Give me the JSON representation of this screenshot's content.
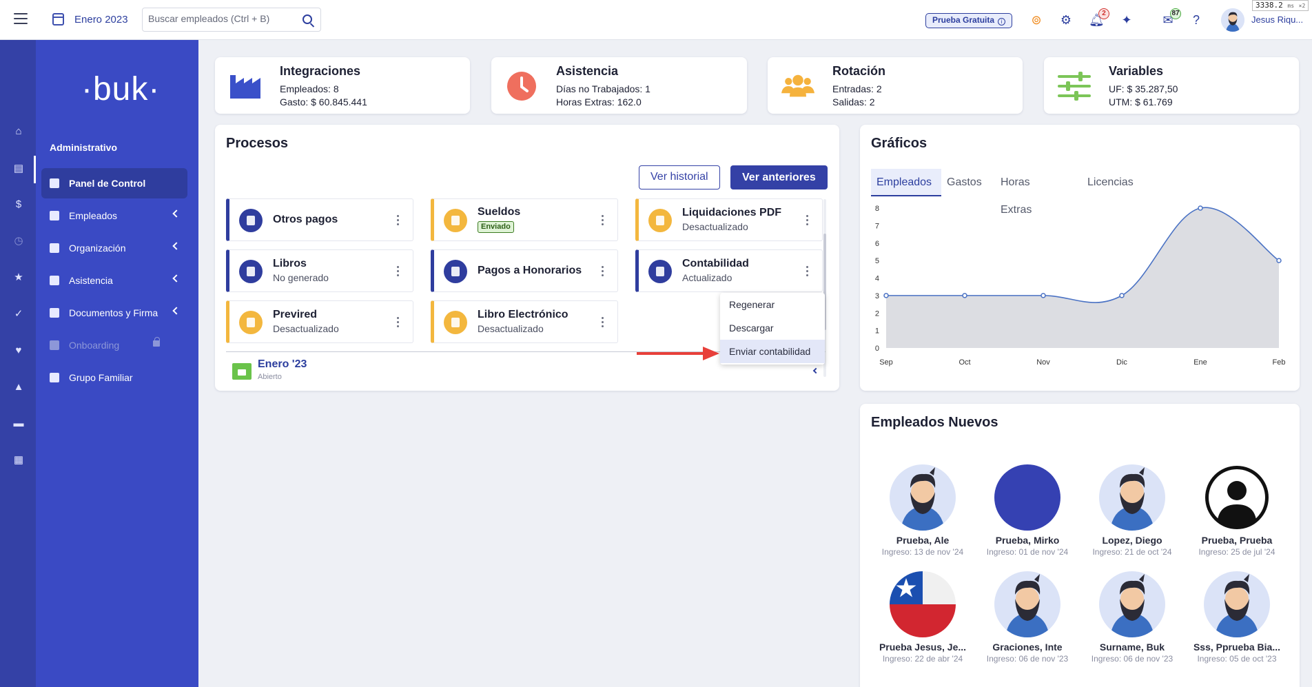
{
  "header": {
    "period": "Enero 2023",
    "search_placeholder": "Buscar empleados (Ctrl + B)",
    "trial_label": "Prueba Gratuita",
    "notifications_count": "2",
    "messages_count": "87",
    "user_name": "Jesus Riqu...",
    "timing": "3338.2",
    "timing_unit": "ms",
    "timing_suffix": "×2"
  },
  "sidebar": {
    "logo": "·buk·",
    "section": "Administrativo",
    "items": [
      {
        "label": "Panel de Control"
      },
      {
        "label": "Empleados"
      },
      {
        "label": "Organización"
      },
      {
        "label": "Asistencia"
      },
      {
        "label": "Documentos y Firma"
      },
      {
        "label": "Onboarding"
      },
      {
        "label": "Grupo Familiar"
      }
    ]
  },
  "kpis": [
    {
      "title": "Integraciones",
      "l1": "Empleados: 8",
      "l2": "Gasto: $ 60.845.441"
    },
    {
      "title": "Asistencia",
      "l1": "Días no Trabajados: 1",
      "l2": "Horas Extras: 162.0"
    },
    {
      "title": "Rotación",
      "l1": "Entradas: 2",
      "l2": "Salidas: 2"
    },
    {
      "title": "Variables",
      "l1": "UF: $ 35.287,50",
      "l2": "UTM: $ 61.769"
    }
  ],
  "processes": {
    "title": "Procesos",
    "btn_history": "Ver historial",
    "btn_previous": "Ver anteriores",
    "cards": [
      {
        "title": "Otros pagos",
        "sub": ""
      },
      {
        "title": "Sueldos",
        "tag": "Enviado"
      },
      {
        "title": "Liquidaciones PDF",
        "sub": "Desactualizado"
      },
      {
        "title": "Libros",
        "sub": "No generado"
      },
      {
        "title": "Pagos a Honorarios",
        "sub": ""
      },
      {
        "title": "Contabilidad",
        "sub": "Actualizado"
      },
      {
        "title": "Previred",
        "sub": "Desactualizado"
      },
      {
        "title": "Libro Electrónico",
        "sub": "Desactualizado"
      }
    ],
    "menu": [
      "Regenerar",
      "Descargar",
      "Enviar contabilidad"
    ],
    "period_name": "Enero '23",
    "period_status": "Abierto"
  },
  "charts_card": {
    "title": "Gráficos",
    "tabs": [
      "Empleados",
      "Gastos",
      "Horas Extras",
      "Licencias"
    ]
  },
  "chart_data": {
    "type": "area",
    "categories": [
      "Sep",
      "Oct",
      "Nov",
      "Dic",
      "Ene",
      "Feb"
    ],
    "values": [
      3,
      3,
      3,
      3,
      8,
      5
    ],
    "ylim": [
      0,
      8
    ],
    "yticks": [
      "0",
      "1",
      "2",
      "3",
      "4",
      "5",
      "6",
      "7",
      "8"
    ],
    "grid": false,
    "colors": {
      "line": "#4a72c4",
      "fill": "#dcdde2"
    }
  },
  "new_employees": {
    "title": "Empleados Nuevos",
    "items": [
      {
        "name": "Prueba, Ale",
        "date": "Ingreso: 13 de nov '24",
        "avatar": "bearded"
      },
      {
        "name": "Prueba, Mirko",
        "date": "Ingreso: 01 de nov '24",
        "avatar": "blue"
      },
      {
        "name": "Lopez, Diego",
        "date": "Ingreso: 21 de oct '24",
        "avatar": "bearded"
      },
      {
        "name": "Prueba, Prueba",
        "date": "Ingreso: 25 de jul '24",
        "avatar": "silhouette"
      },
      {
        "name": "Prueba Jesus, Je...",
        "date": "Ingreso: 22 de abr '24",
        "avatar": "chile-flag"
      },
      {
        "name": "Graciones, Inte",
        "date": "Ingreso: 06 de nov '23",
        "avatar": "bearded"
      },
      {
        "name": "Surname, Buk",
        "date": "Ingreso: 06 de nov '23",
        "avatar": "bearded"
      },
      {
        "name": "Sss, Pprueba Bia...",
        "date": "Ingreso: 05 de oct '23",
        "avatar": "bearded"
      }
    ]
  }
}
